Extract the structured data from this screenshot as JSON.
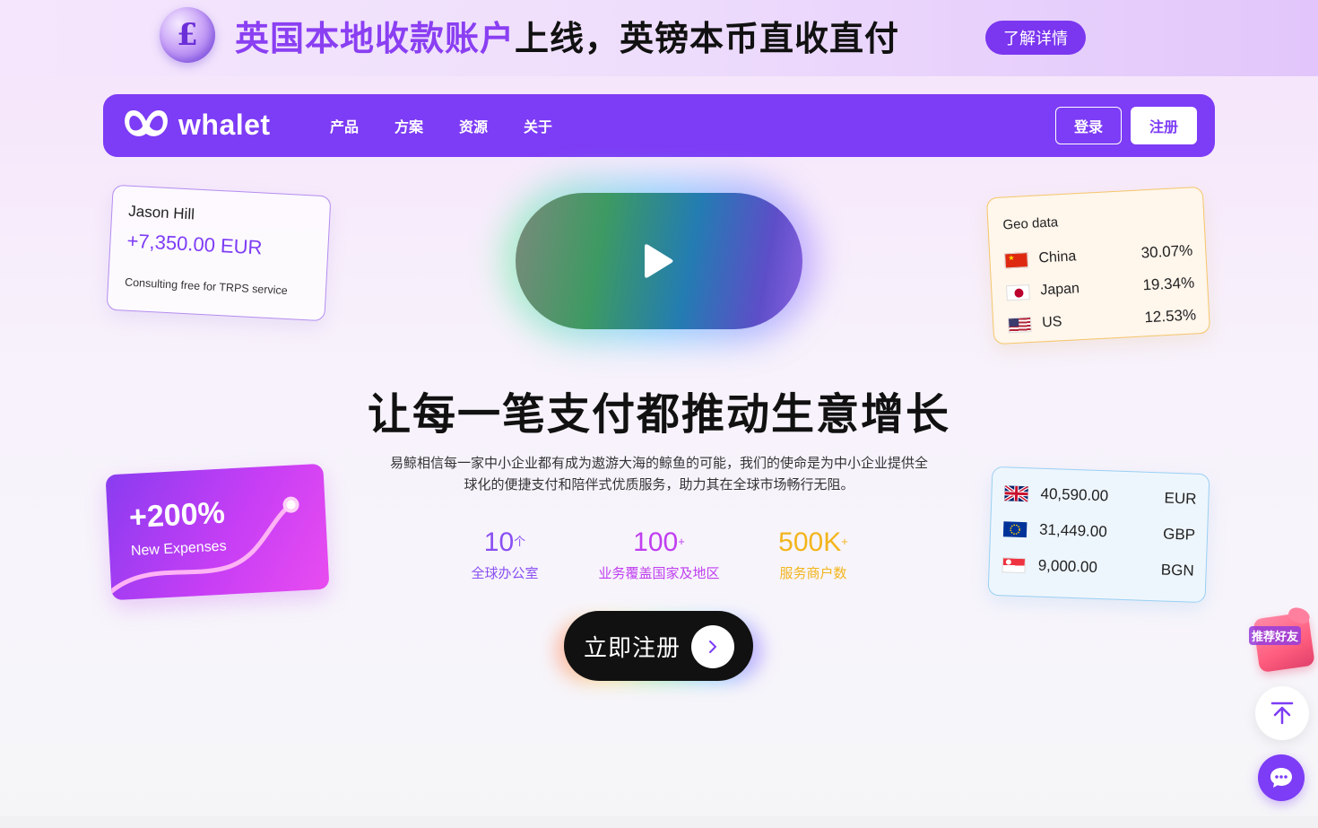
{
  "promo": {
    "coin_symbol": "£",
    "title_highlight": "英国本地收款账户",
    "title_rest": "上线，英镑本币直收直付",
    "button_label": "了解详情"
  },
  "nav": {
    "logo_text": "whalet",
    "items": [
      {
        "label": "产品"
      },
      {
        "label": "方案"
      },
      {
        "label": "资源"
      },
      {
        "label": "关于"
      }
    ],
    "login_label": "登录",
    "register_label": "注册"
  },
  "payer_card": {
    "name": "Jason Hill",
    "amount": "+7,350.00 EUR",
    "note": "Consulting free for TRPS service"
  },
  "geo_card": {
    "title": "Geo data",
    "rows": [
      {
        "country": "China",
        "percent": "30.07%",
        "flag_icon": "china-flag-icon"
      },
      {
        "country": "Japan",
        "percent": "19.34%",
        "flag_icon": "japan-flag-icon"
      },
      {
        "country": "US",
        "percent": "12.53%",
        "flag_icon": "us-flag-icon"
      }
    ]
  },
  "growth_card": {
    "value": "+200%",
    "label": "New Expenses"
  },
  "fx_card": {
    "rows": [
      {
        "amount": "40,590.00",
        "currency": "EUR",
        "flag_icon": "uk-flag-icon"
      },
      {
        "amount": "31,449.00",
        "currency": "GBP",
        "flag_icon": "eu-flag-icon"
      },
      {
        "amount": "9,000.00",
        "currency": "BGN",
        "flag_icon": "singapore-flag-icon"
      }
    ]
  },
  "hero": {
    "headline": "让每一笔支付都推动生意增长",
    "description": "易鲸相信每一家中小企业都有成为遨游大海的鲸鱼的可能，我们的使命是为中小企业提供全球化的便捷支付和陪伴式优质服务，助力其在全球市场畅行无阻。"
  },
  "stats": [
    {
      "value": "10",
      "suffix": "个",
      "label": "全球办公室",
      "color": "#8a4ff2"
    },
    {
      "value": "100",
      "suffix": "+",
      "label": "业务覆盖国家及地区",
      "color": "#c03ef0"
    },
    {
      "value": "500K",
      "suffix": "+",
      "label": "服务商户数",
      "color": "#f3b51c"
    }
  ],
  "cta": {
    "label": "立即注册"
  },
  "widgets": {
    "refer_label": "推荐好友"
  },
  "colors": {
    "brand": "#7d3cf5",
    "accent_pink": "#e94cf0",
    "accent_yellow": "#f3b51c"
  }
}
